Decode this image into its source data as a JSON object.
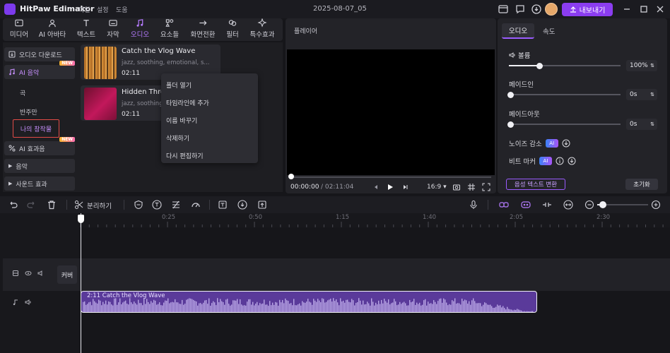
{
  "app": {
    "name": "HitPaw Edimakor",
    "menu": [
      "파일",
      "설정",
      "도움"
    ],
    "doc_title": "2025-08-07_05",
    "export_label": "내보내기"
  },
  "media_tabs": [
    {
      "label": "미디어",
      "icon": "media-icon"
    },
    {
      "label": "AI 아바타",
      "icon": "ai-avatar-icon"
    },
    {
      "label": "텍스트",
      "icon": "text-icon"
    },
    {
      "label": "자막",
      "icon": "subtitle-icon"
    },
    {
      "label": "오디오",
      "icon": "audio-icon",
      "active": true
    },
    {
      "label": "요소들",
      "icon": "elements-icon"
    },
    {
      "label": "화면전환",
      "icon": "transition-icon"
    },
    {
      "label": "필터",
      "icon": "filter-icon"
    },
    {
      "label": "특수효과",
      "icon": "effects-icon"
    }
  ],
  "sidebar": {
    "audio_download": "오디오 다운로드",
    "ai_music": "AI 음악",
    "new_badge": "NEW",
    "sub_items": [
      "곡",
      "반주만",
      "나의 창작물"
    ],
    "ai_sfx": "AI 효과음",
    "music": "음악",
    "sound_effects": "사운드 효과"
  },
  "tracks": [
    {
      "title": "Catch the Vlog Wave",
      "desc": "jazz, soothing, emotional, s...",
      "duration": "02:11"
    },
    {
      "title": "Hidden Threa",
      "desc": "jazz, soothing",
      "duration": "02:11"
    }
  ],
  "context_menu": [
    "폴더 열기",
    "타임라인에 추가",
    "이름 바꾸기",
    "삭제하기",
    "다시 편집하기"
  ],
  "player": {
    "title": "플레이어",
    "current": "00:00:00",
    "total": "/ 02:11:04",
    "ratio": "16:9"
  },
  "props": {
    "tab_audio": "오디오",
    "tab_speed": "속도",
    "volume_label": "볼륨",
    "volume_value": "100%",
    "volume_level": 0.27,
    "fadein_label": "페이드인",
    "fadein_value": "0s",
    "fadeout_label": "페이드아웃",
    "fadeout_value": "0s",
    "noise_label": "노이즈 감소",
    "beat_label": "비트 마커",
    "ai_tag": "AI",
    "stt_label": "음성 텍스트 변환",
    "reset_label": "초기화"
  },
  "timeline": {
    "split_label": "분리하기",
    "ticks": [
      "0:25",
      "0:50",
      "1:15",
      "1:40",
      "2:05",
      "2:30"
    ],
    "cover_label": "커버",
    "clip_label": "2:11 Catch the Vlog Wave"
  },
  "colors": {
    "accent": "#8b3df0",
    "clip": "#5a3a9a",
    "wave": "#b9a6e6"
  }
}
